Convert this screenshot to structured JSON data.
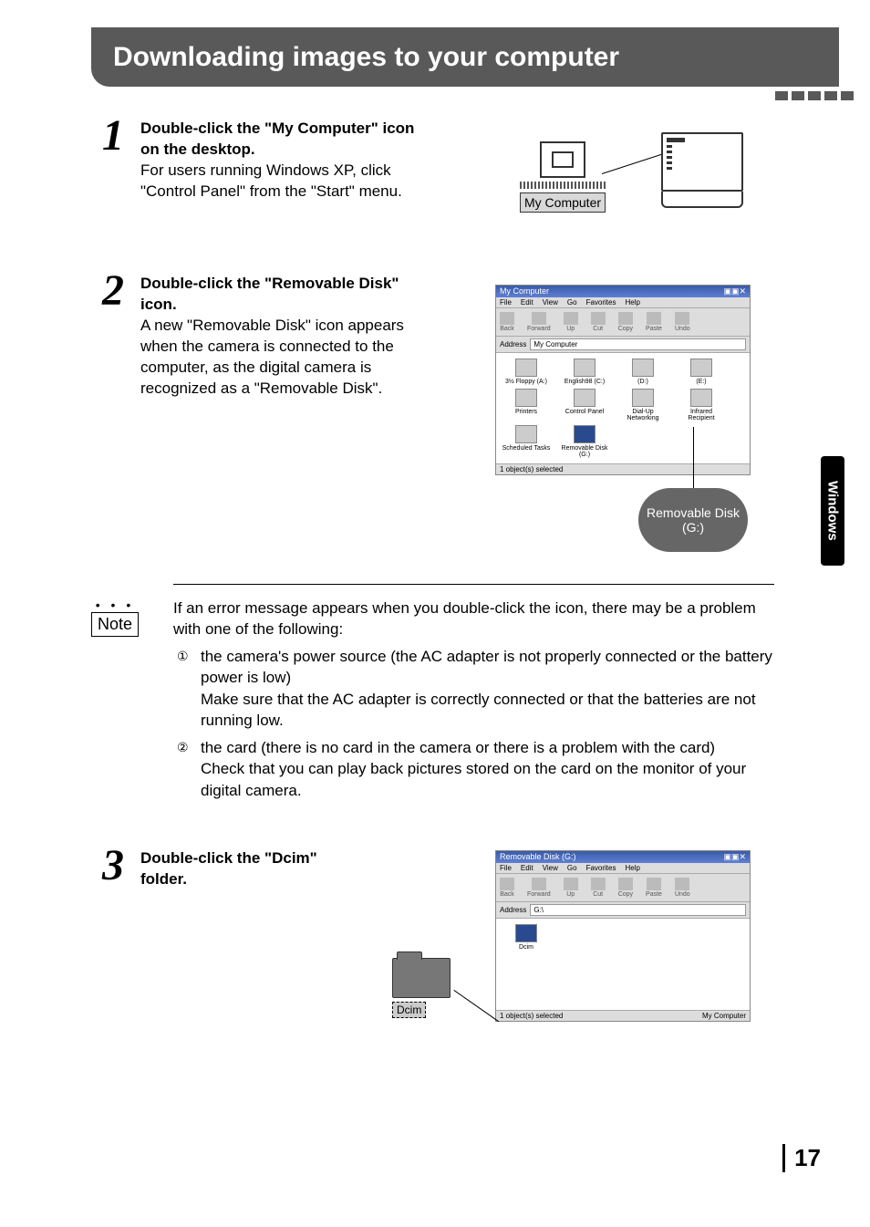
{
  "header": {
    "title": "Downloading images to your computer"
  },
  "side_tab": "Windows",
  "page_number": "17",
  "steps": {
    "s1": {
      "num": "1",
      "head": "Double-click the \"My Computer\" icon on the desktop.",
      "body": "For users running Windows XP, click \"Control Panel\" from the \"Start\" menu."
    },
    "s2": {
      "num": "2",
      "head": "Double-click the \"Removable Disk\" icon.",
      "body": "A new \"Removable Disk\" icon appears when the camera is connected to the computer, as the digital camera is recognized as a \"Removable Disk\"."
    },
    "s3": {
      "num": "3",
      "head": "Double-click the \"Dcim\" folder."
    }
  },
  "note": {
    "label": "Note",
    "intro": "If an error message appears when you double-click the icon, there may be a problem with one of the following:",
    "items": [
      {
        "marker": "①",
        "lead": "the camera's power source (the AC adapter is not properly connected or the battery power is low)",
        "follow": "Make sure that the AC adapter is correctly connected or that the batteries are not running low."
      },
      {
        "marker": "②",
        "lead": "the card (there is no card in the camera or there is a problem with the card)",
        "follow": "Check that you can play back pictures stored on the card on the monitor of your digital camera."
      }
    ]
  },
  "figures": {
    "mycomp_label": "My Computer",
    "win_mycomp": {
      "title": "My Computer",
      "menu": [
        "File",
        "Edit",
        "View",
        "Go",
        "Favorites",
        "Help"
      ],
      "toolbar": [
        "Back",
        "Forward",
        "Up",
        "Cut",
        "Copy",
        "Paste",
        "Undo"
      ],
      "address_label": "Address",
      "address_value": "My Computer",
      "drives": [
        "3½ Floppy (A:)",
        "English98 (C:)",
        "(D:)",
        "(E:)",
        "Printers",
        "Control Panel",
        "Dial-Up Networking",
        "Infrared Recipient",
        "Scheduled Tasks",
        "Removable Disk (G:)"
      ],
      "status": "1 object(s) selected",
      "callout": "Removable Disk (G:)"
    },
    "win_remov": {
      "title": "Removable Disk (G:)",
      "menu": [
        "File",
        "Edit",
        "View",
        "Go",
        "Favorites",
        "Help"
      ],
      "toolbar": [
        "Back",
        "Forward",
        "Up",
        "Cut",
        "Copy",
        "Paste",
        "Undo"
      ],
      "address_label": "Address",
      "address_value": "G:\\",
      "folder": "Dcim",
      "status_left": "1 object(s) selected",
      "status_right": "My Computer",
      "callout": "Dcim"
    }
  }
}
